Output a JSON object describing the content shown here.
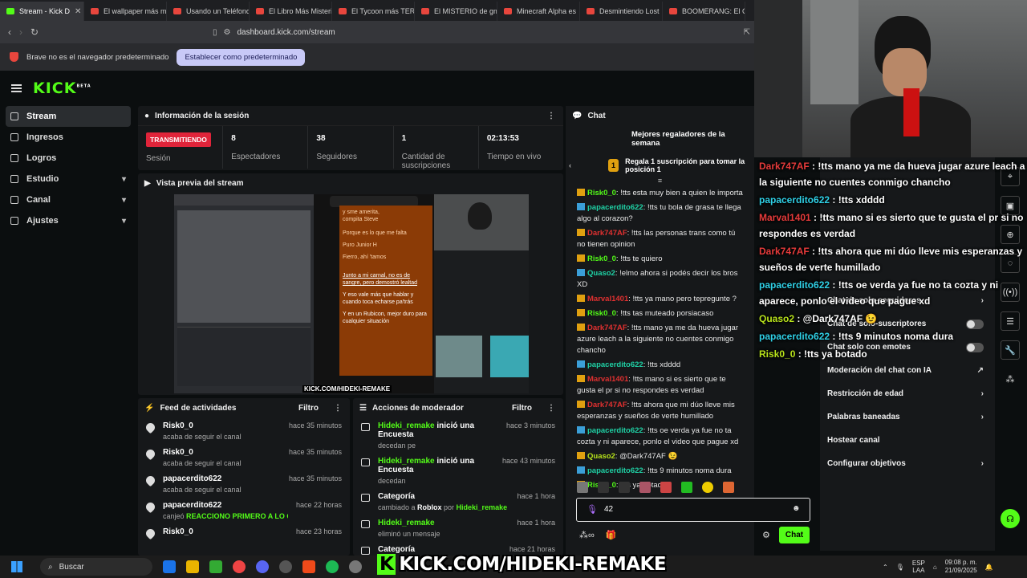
{
  "browser": {
    "tabs": [
      {
        "label": "Stream - Kick D",
        "active": true
      },
      {
        "label": "El wallpaper más m"
      },
      {
        "label": "Usando un Teléfono"
      },
      {
        "label": "El Libro Más Misterio"
      },
      {
        "label": "El Tycoon más TERR"
      },
      {
        "label": "El MISTERIO de gm"
      },
      {
        "label": "Minecraft Alpha es"
      },
      {
        "label": "Desmintiendo Lost"
      },
      {
        "label": "BOOMERANG: El C"
      }
    ],
    "url": "dashboard.kick.com/stream",
    "infobar_text": "Brave no es el navegador predeterminado",
    "infobar_button": "Establecer como predeterminado"
  },
  "sidebar": {
    "items": [
      {
        "label": "Stream",
        "active": true
      },
      {
        "label": "Ingresos"
      },
      {
        "label": "Logros"
      },
      {
        "label": "Estudio",
        "chevron": "▾"
      },
      {
        "label": "Canal",
        "chevron": "▾"
      },
      {
        "label": "Ajustes",
        "chevron": "▾"
      }
    ]
  },
  "session": {
    "title": "Información de la sesión",
    "status": "TRANSMITIENDO",
    "status_label": "Sesión",
    "stats": [
      {
        "value": "8",
        "label": "Espectadores"
      },
      {
        "value": "38",
        "label": "Seguidores"
      },
      {
        "value": "1",
        "label": "Cantidad de suscripciones"
      },
      {
        "value": "02:13:53",
        "label": "Tiempo en vivo"
      }
    ]
  },
  "preview": {
    "title": "Vista previa del stream",
    "lyrics": [
      "y sme amerita,",
      "compita Steve",
      "Porque es lo que me falta",
      "Puro Junior H",
      "Fierro, ahí 'tamos",
      "Junto a mi carnal, no es de sangre, pero demostró lealtad",
      "Y eso vale más que hablar y cuando toca echarse pa'trás",
      "Y en un Rubicon, mejor duro para cualquier situación"
    ],
    "watermark": "KICK.COM/HIDEKI-REMAKE"
  },
  "feed": {
    "title": "Feed de actividades",
    "filter": "Filtro",
    "items": [
      {
        "user": "Risk0_0",
        "text": "acaba de seguir el canal",
        "time": "hace 35 minutos"
      },
      {
        "user": "Risk0_0",
        "text": "acaba de seguir el canal",
        "time": "hace 35 minutos"
      },
      {
        "user": "papacerdito622",
        "text": "acaba de seguir el canal",
        "time": "hace 35 minutos"
      },
      {
        "user": "papacerdito622",
        "text_pre": "canjeó ",
        "text_hl": "REACCIONO PRIMERO A LO QUE ME MANDES",
        "time": "hace 22 horas"
      },
      {
        "user": "Risk0_0",
        "text": "",
        "time": "hace 23 horas"
      }
    ]
  },
  "mods": {
    "title": "Acciones de moderador",
    "filter": "Filtro",
    "items": [
      {
        "user": "Hideki_remake",
        "action": " inició una Encuesta",
        "sub": "decedan pe",
        "time": "hace 3 minutos"
      },
      {
        "user": "Hideki_remake",
        "action": " inició una Encuesta",
        "sub": "decedan",
        "time": "hace 43 minutos"
      },
      {
        "user": "Categoría",
        "action": "",
        "sub_pre": "cambiado a ",
        "sub_b": "Roblox",
        "sub_mid": " por ",
        "sub_g": "Hideki_remake",
        "time": "hace 1 hora"
      },
      {
        "user": "Hideki_remake",
        "action": "",
        "sub": "eliminó un mensaje",
        "time": "hace 1 hora"
      },
      {
        "user": "Categoría",
        "action": "",
        "sub": "",
        "time": "hace 21 horas"
      }
    ]
  },
  "chat": {
    "title": "Chat",
    "gifters_title": "Mejores regaladores de la semana",
    "gifters_cta": "Regala 1 suscripción para tomar la posición 1",
    "messages": [
      {
        "user": "Risk0_0",
        "c": "u1",
        "text": ": !tts esta muy bien a quien le importa"
      },
      {
        "user": "papacerdito622",
        "c": "u2",
        "text": ": !tts tu bola de grasa te llega algo al corazon?"
      },
      {
        "user": "Dark747AF",
        "c": "u3",
        "text": ": !tts las personas trans como tú no tienen opinion"
      },
      {
        "user": "Risk0_0",
        "c": "u1",
        "text": ": !tts te quiero"
      },
      {
        "user": "Quaso2",
        "c": "u2",
        "text": ": !elmo ahora si podés decir los bros XD"
      },
      {
        "user": "Marval1401",
        "c": "u3",
        "text": ": !tts ya mano pero tepregunte ?"
      },
      {
        "user": "Risk0_0",
        "c": "u1",
        "text": ": !tts tas muteado porsiacaso"
      },
      {
        "user": "Dark747AF",
        "c": "u3",
        "text": ": !tts mano ya me da hueva jugar azure leach a la siguiente no cuentes conmigo chancho"
      },
      {
        "user": "papacerdito622",
        "c": "u2",
        "text": ": !tts xdddd"
      },
      {
        "user": "Marval1401",
        "c": "u3",
        "text": ": !tts mano si es sierto que te gusta el pr si no respondes es verdad"
      },
      {
        "user": "Dark747AF",
        "c": "u3",
        "text": ": !tts ahora que mi dúo lleve mis esperanzas y sueños de verte humillado"
      },
      {
        "user": "papacerdito622",
        "c": "u2",
        "text": ": !tts oe verda ya fue no ta cozta y ni aparece, ponlo el video que pague xd"
      },
      {
        "user": "Quaso2",
        "c": "u4",
        "text": ": @Dark747AF 😉"
      },
      {
        "user": "papacerdito622",
        "c": "u2",
        "text": ": !tts 9 minutos noma dura"
      },
      {
        "user": "Risk0_0",
        "c": "u1",
        "text": ": !tts ya botado"
      }
    ],
    "input_value": "42",
    "send": "Chat"
  },
  "menu": {
    "items": [
      {
        "label": "Chat de solo-seguidores",
        "type": "arrow"
      },
      {
        "label": "Chat de solo-suscriptores",
        "type": "toggle"
      },
      {
        "label": "Chat solo con emotes",
        "type": "toggle"
      },
      {
        "label": "Moderación del chat con IA",
        "type": "ext"
      },
      {
        "label": "Restricción de edad",
        "type": "arrow"
      },
      {
        "label": "Palabras baneadas",
        "type": "arrow"
      },
      {
        "label": "Hostear canal",
        "type": "none"
      },
      {
        "label": "Configurar objetivos",
        "type": "arrow"
      }
    ]
  },
  "overlay": {
    "lines": [
      {
        "user": "Dark747AF",
        "c": "o1",
        "text": " : !tts mano ya me da hueva jugar azure leach a la siguiente no cuentes conmigo chancho"
      },
      {
        "user": "papacerdito622",
        "c": "o2",
        "text": " : !tts xdddd"
      },
      {
        "user": "Marval1401",
        "c": "o3",
        "text": " : !tts mano si es sierto que te gusta el pr si no respondes es verdad"
      },
      {
        "user": "Dark747AF",
        "c": "o1",
        "text": " : !tts ahora que mi dúo lleve mis esperanzas y sueños de verte humillado"
      },
      {
        "user": "papacerdito622",
        "c": "o2",
        "text": " : !tts oe verda ya fue no ta cozta y ni aparece, ponlo el video que pague xd"
      },
      {
        "user": "Quaso2",
        "c": "o4",
        "text": " : @Dark747AF 😉"
      },
      {
        "user": "papacerdito622",
        "c": "o2",
        "text": " : !tts 9 minutos noma dura"
      },
      {
        "user": "Risk0_0",
        "c": "o4",
        "text": " : !tts ya botado"
      }
    ]
  },
  "taskbar": {
    "search": "Buscar",
    "banner_k": "K",
    "banner": "KICK.COM/HIDEKI-REMAKE",
    "lang": "ESP",
    "lang2": "LAA",
    "time": "09:08 p. m.",
    "date": "21/09/2025"
  },
  "colors": {
    "kick_green": "#53fc18",
    "live_red": "#e0243a"
  }
}
